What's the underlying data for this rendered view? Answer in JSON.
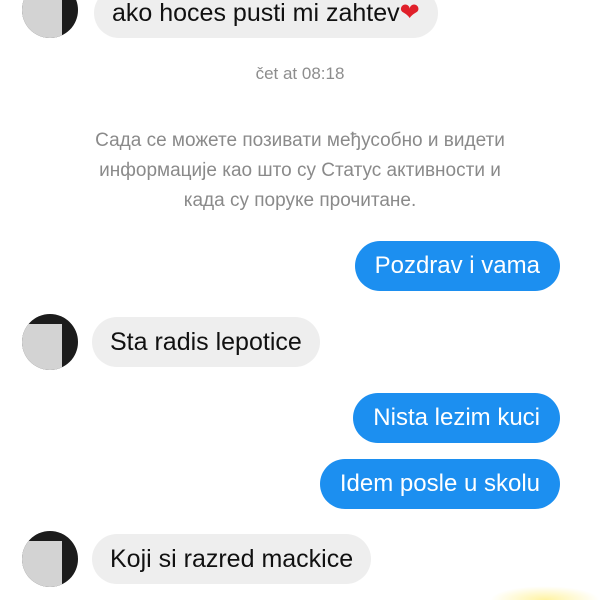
{
  "messages": [
    {
      "side": "in",
      "text": "ako hoces pusti mi zahtev"
    },
    {
      "side": "out",
      "text": "Pozdrav i vama"
    },
    {
      "side": "in",
      "text": "Sta radis lepotice"
    },
    {
      "side": "out",
      "text": "Nista lezim kuci"
    },
    {
      "side": "out",
      "text": "Idem posle u skolu"
    },
    {
      "side": "in",
      "text": "Koji si razred mackice"
    }
  ],
  "timestamp": "čet at 08:18",
  "notice": {
    "line1": "Сада се можете позивати међусобно и видети",
    "line2": "информације као што су Статус активности и",
    "line3": "када су поруке прочитане."
  },
  "icons": {
    "heart": "heart-emoji",
    "avatar": "blurred-profile-avatar"
  },
  "colors": {
    "outgoing_bubble": "#1c8ff0",
    "incoming_bubble": "#eeeeee",
    "meta_text": "#8d8d8d"
  }
}
